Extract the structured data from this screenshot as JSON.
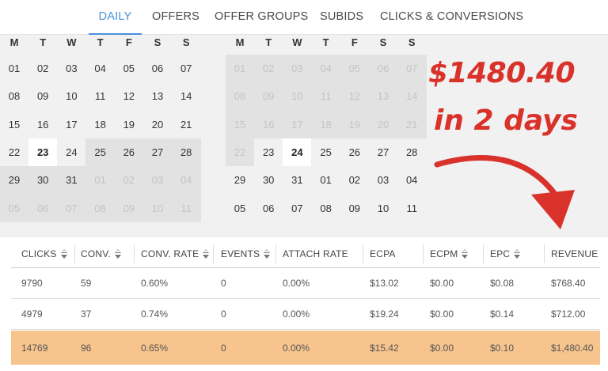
{
  "tabs": [
    {
      "label": "DAILY",
      "active": true
    },
    {
      "label": "OFFERS"
    },
    {
      "label": "OFFER GROUPS"
    },
    {
      "label": "SUBIDS"
    },
    {
      "label": "CLICKS & CONVERSIONS"
    }
  ],
  "calendar": {
    "weekdays": [
      "M",
      "T",
      "W",
      "T",
      "F",
      "S",
      "S"
    ],
    "left": {
      "weeks": [
        [
          "01",
          "02",
          "03",
          "04",
          "05",
          "06",
          "07"
        ],
        [
          "08",
          "09",
          "10",
          "11",
          "12",
          "13",
          "14"
        ],
        [
          "15",
          "16",
          "17",
          "18",
          "19",
          "20",
          "21"
        ],
        [
          "22",
          "23",
          "24",
          "25",
          "26",
          "27",
          "28"
        ],
        [
          "29",
          "30",
          "31",
          "01",
          "02",
          "03",
          "04"
        ],
        [
          "05",
          "06",
          "07",
          "08",
          "09",
          "10",
          "11"
        ]
      ],
      "selected": "23"
    },
    "right": {
      "weeks": [
        [
          "01",
          "02",
          "03",
          "04",
          "05",
          "06",
          "07"
        ],
        [
          "08",
          "09",
          "10",
          "11",
          "12",
          "13",
          "14"
        ],
        [
          "15",
          "16",
          "17",
          "18",
          "19",
          "20",
          "21"
        ],
        [
          "22",
          "23",
          "24",
          "25",
          "26",
          "27",
          "28"
        ],
        [
          "29",
          "30",
          "31",
          "01",
          "02",
          "03",
          "04"
        ],
        [
          "05",
          "06",
          "07",
          "08",
          "09",
          "10",
          "11"
        ]
      ],
      "selected": "24"
    }
  },
  "promo": {
    "amount": "$1480.40",
    "caption": "in 2 days",
    "color": "#d9322a"
  },
  "table": {
    "columns": [
      {
        "label": "CLICKS",
        "sortable": true
      },
      {
        "label": "CONV.",
        "sortable": true
      },
      {
        "label": "CONV. RATE",
        "sortable": true
      },
      {
        "label": "EVENTS",
        "sortable": true
      },
      {
        "label": "ATTACH RATE",
        "sortable": false
      },
      {
        "label": "ECPA",
        "sortable": false
      },
      {
        "label": "ECPM",
        "sortable": true
      },
      {
        "label": "EPC",
        "sortable": true
      },
      {
        "label": "REVENUE",
        "sortable": false
      }
    ],
    "rows": [
      [
        "9790",
        "59",
        "0.60%",
        "0",
        "0.00%",
        "$13.02",
        "$0.00",
        "$0.08",
        "$768.40"
      ],
      [
        "4979",
        "37",
        "0.74%",
        "0",
        "0.00%",
        "$19.24",
        "$0.00",
        "$0.14",
        "$712.00"
      ],
      [
        "14769",
        "96",
        "0.65%",
        "0",
        "0.00%",
        "$15.42",
        "$0.00",
        "$0.10",
        "$1,480.40"
      ]
    ],
    "total_row_color": "#f7c48d"
  }
}
